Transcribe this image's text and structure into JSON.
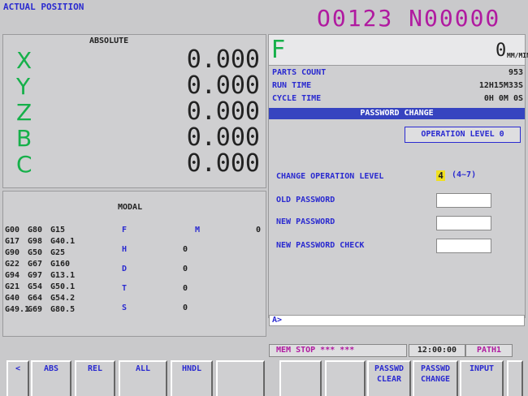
{
  "header": {
    "title": "ACTUAL POSITION",
    "program": "O0123 N00000"
  },
  "absolute": {
    "label": "ABSOLUTE",
    "axes": [
      {
        "name": "X",
        "value": "0.000"
      },
      {
        "name": "Y",
        "value": "0.000"
      },
      {
        "name": "Z",
        "value": "0.000"
      },
      {
        "name": "B",
        "value": "0.000"
      },
      {
        "name": "C",
        "value": "0.000"
      }
    ]
  },
  "modal": {
    "label": "MODAL",
    "rows": [
      [
        "G00",
        "G80",
        "G15"
      ],
      [
        "G17",
        "G98",
        "G40.1"
      ],
      [
        "G90",
        "G50",
        "G25"
      ],
      [
        "G22",
        "G67",
        "G160"
      ],
      [
        "G94",
        "G97",
        "G13.1"
      ],
      [
        "G21",
        "G54",
        "G50.1"
      ],
      [
        "G40",
        "G64",
        "G54.2"
      ],
      [
        "G49.1",
        "G69",
        "G80.5"
      ]
    ],
    "codes": [
      {
        "letter": "F",
        "value": ""
      },
      {
        "letter": "M",
        "value": "0"
      },
      {
        "letter": "H",
        "value": "0"
      },
      {
        "letter": "D",
        "value": "0"
      },
      {
        "letter": "T",
        "value": "0"
      },
      {
        "letter": "S",
        "value": "0"
      }
    ]
  },
  "feed": {
    "letter": "F",
    "value": "0",
    "unit": "MM/MIN"
  },
  "info": {
    "parts_count_label": "PARTS COUNT",
    "parts_count": "953",
    "run_time_label": "RUN TIME",
    "run_time": "12H15M33S",
    "cycle_time_label": "CYCLE TIME",
    "cycle_time": "0H 0M 0S"
  },
  "password": {
    "header": "PASSWORD CHANGE",
    "op_level_button": "OPERATION LEVEL 0",
    "change_level_label": "CHANGE OPERATION LEVEL",
    "change_level_value": "4",
    "change_level_range": "(4~7)",
    "old_label": "OLD PASSWORD",
    "new_label": "NEW PASSWORD",
    "check_label": "NEW PASSWORD CHECK"
  },
  "prompt": "A>",
  "status": {
    "mode": "MEM  STOP *** ***",
    "clock": "12:00:00",
    "path": "PATH1"
  },
  "softkeys": {
    "prev": "<",
    "abs": "ABS",
    "rel": "REL",
    "all": "ALL",
    "hndl": "HNDL",
    "pw_clear_1": "PASSWD",
    "pw_clear_2": "CLEAR",
    "pw_change_1": "PASSWD",
    "pw_change_2": "CHANGE",
    "input": "INPUT"
  },
  "colors": {
    "accent": "#2a2ad0",
    "program": "#b01aa0",
    "axis": "#16b04a",
    "header_bar": "#3644c0"
  }
}
